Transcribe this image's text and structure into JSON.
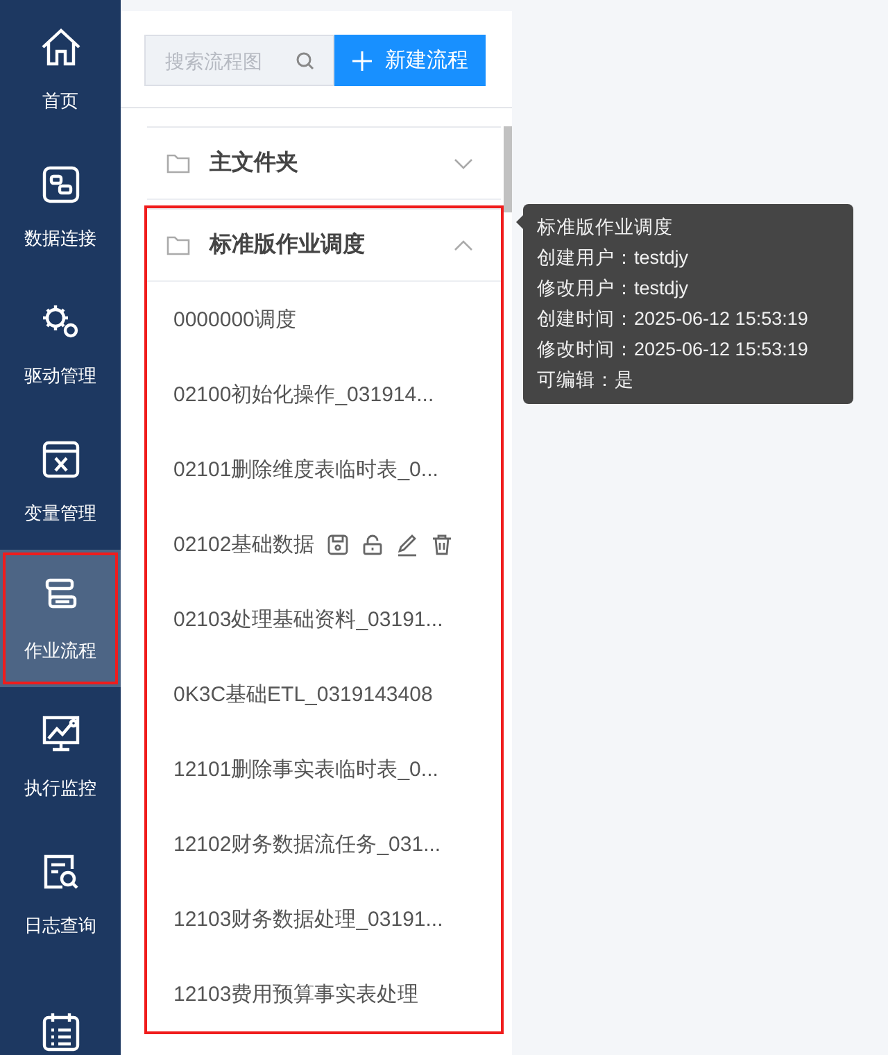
{
  "nav": [
    {
      "label": "首页",
      "selected": false,
      "outlined": false
    },
    {
      "label": "数据连接",
      "selected": false,
      "outlined": false
    },
    {
      "label": "驱动管理",
      "selected": false,
      "outlined": false
    },
    {
      "label": "变量管理",
      "selected": false,
      "outlined": false
    },
    {
      "label": "作业流程",
      "selected": true,
      "outlined": true
    },
    {
      "label": "执行监控",
      "selected": false,
      "outlined": false
    },
    {
      "label": "日志查询",
      "selected": false,
      "outlined": false
    },
    {
      "selected": false,
      "outlined": false
    }
  ],
  "search": {
    "placeholder": "搜索流程图"
  },
  "new_button": "新建流程",
  "folders": [
    {
      "name": "主文件夹",
      "expanded": false,
      "outlined": false
    },
    {
      "name": "标准版作业调度",
      "expanded": true,
      "outlined": true,
      "items": [
        {
          "name": "0000000调度",
          "hovered": false
        },
        {
          "name": "02100初始化操作_031914...",
          "hovered": false
        },
        {
          "name": "02101删除维度表临时表_0...",
          "hovered": false
        },
        {
          "name": "02102基础数据",
          "hovered": true
        },
        {
          "name": "02103处理基础资料_03191...",
          "hovered": false
        },
        {
          "name": "0K3C基础ETL_0319143408",
          "hovered": false
        },
        {
          "name": "12101删除事实表临时表_0...",
          "hovered": false
        },
        {
          "name": "12102财务数据流任务_031...",
          "hovered": false
        },
        {
          "name": "12103财务数据处理_03191...",
          "hovered": false
        },
        {
          "name": "12103费用预算事实表处理",
          "hovered": false
        }
      ]
    }
  ],
  "tooltip": {
    "lines": [
      "标准版作业调度",
      "创建用户：testdjy",
      "修改用户：testdjy",
      "创建时间：2025-06-12 15:53:19",
      "修改时间：2025-06-12 15:53:19",
      "可编辑：是"
    ]
  }
}
